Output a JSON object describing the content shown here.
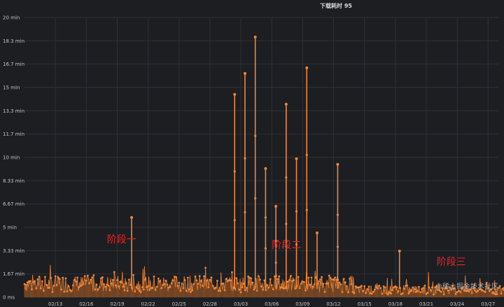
{
  "chart_data": {
    "type": "line",
    "title": "下载耗时 95",
    "yticks": [
      "20 min",
      "18.3 min",
      "16.7 min",
      "15 min",
      "13.3 min",
      "11.7 min",
      "10 min",
      "8.33 min",
      "6.67 min",
      "5 min",
      "3.33 min",
      "1.67 min",
      "0 ms"
    ],
    "ylim_minutes": [
      0,
      20
    ],
    "xticks": [
      "02/13",
      "02/16",
      "02/19",
      "02/22",
      "02/25",
      "02/28",
      "03/03",
      "03/06",
      "03/09",
      "03/12",
      "03/15",
      "03/18",
      "03/21",
      "03/24",
      "03/27"
    ],
    "x_range": [
      "02/10",
      "03/28"
    ],
    "grid": true,
    "series": [
      {
        "name": "",
        "color": "#f0873a",
        "baseline_minutes": 1.0,
        "spikes": [
          {
            "date": "02/20",
            "minutes": 5.7
          },
          {
            "date": "03/02",
            "minutes": 14.5
          },
          {
            "date": "03/03",
            "minutes": 16.0
          },
          {
            "date": "03/04",
            "minutes": 18.6
          },
          {
            "date": "03/05",
            "minutes": 9.2
          },
          {
            "date": "03/06",
            "minutes": 6.5
          },
          {
            "date": "03/07",
            "minutes": 13.8
          },
          {
            "date": "03/08",
            "minutes": 9.9
          },
          {
            "date": "03/09",
            "minutes": 16.4
          },
          {
            "date": "03/10",
            "minutes": 4.6
          },
          {
            "date": "03/12",
            "minutes": 9.5
          },
          {
            "date": "03/18",
            "minutes": 3.3
          }
        ]
      }
    ],
    "annotations": [
      {
        "text": "阶段一",
        "date": "02/18",
        "minutes": 3.9
      },
      {
        "text": "阶段二",
        "date": "03/06",
        "minutes": 3.5
      },
      {
        "text": "阶段三",
        "date": "03/22",
        "minutes": 2.3
      }
    ],
    "watermark": "@稀土掘金技术社区"
  }
}
